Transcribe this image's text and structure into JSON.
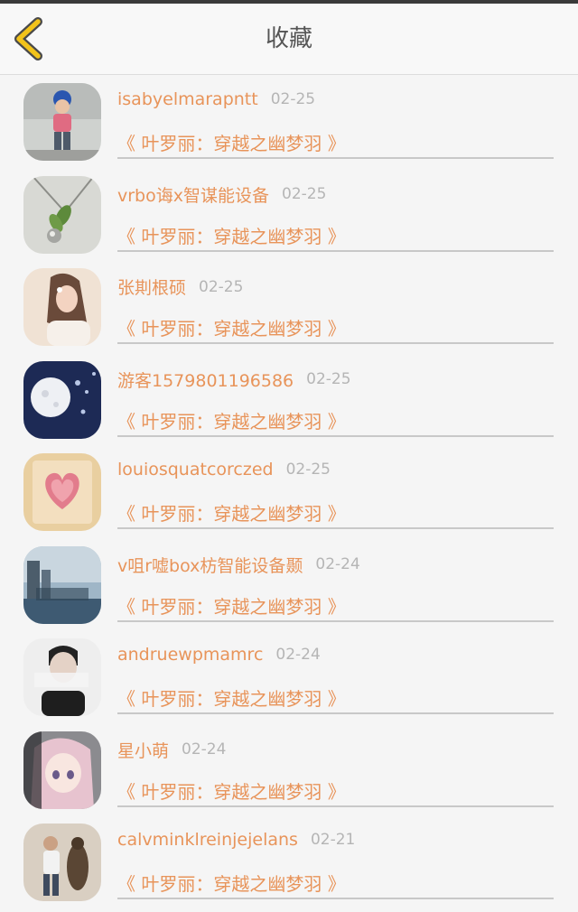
{
  "header": {
    "title": "收藏",
    "back_icon": "chevron-left-icon",
    "back_color": "#f2c31b"
  },
  "colors": {
    "accent": "#e8945a",
    "date": "#b5b5b5",
    "background": "#f5f5f5"
  },
  "favorites": [
    {
      "username": "isabyelmarapntt",
      "date": "02-25",
      "book": "《 叶罗丽：穿越之幽梦羽 》",
      "avatar": "toddler-photo"
    },
    {
      "username": "vrbo诲x智谋能设备",
      "date": "02-25",
      "book": "《 叶罗丽：穿越之幽梦羽 》",
      "avatar": "pendant-photo"
    },
    {
      "username": "张剘根硕",
      "date": "02-25",
      "book": "《 叶罗丽：穿越之幽梦羽 》",
      "avatar": "girl-photo"
    },
    {
      "username": "游客1579801196586",
      "date": "02-25",
      "book": "《 叶罗丽：穿越之幽梦羽 》",
      "avatar": "moon-photo"
    },
    {
      "username": "louiosquatcorczed",
      "date": "02-25",
      "book": "《 叶罗丽：穿越之幽梦羽 》",
      "avatar": "heart-card-photo"
    },
    {
      "username": "v咀r嘘box枋智能设备颞",
      "date": "02-24",
      "book": "《 叶罗丽：穿越之幽梦羽 》",
      "avatar": "city-text-photo"
    },
    {
      "username": "andruewpmamrc",
      "date": "02-24",
      "book": "《 叶罗丽：穿越之幽梦羽 》",
      "avatar": "man-text-photo"
    },
    {
      "username": "星小萌",
      "date": "02-24",
      "book": "《 叶罗丽：穿越之幽梦羽 》",
      "avatar": "anime-girl-photo"
    },
    {
      "username": "calvminklreinjejelans",
      "date": "02-21",
      "book": "《 叶罗丽：穿越之幽梦羽 》",
      "avatar": "man-dog-photo"
    }
  ]
}
